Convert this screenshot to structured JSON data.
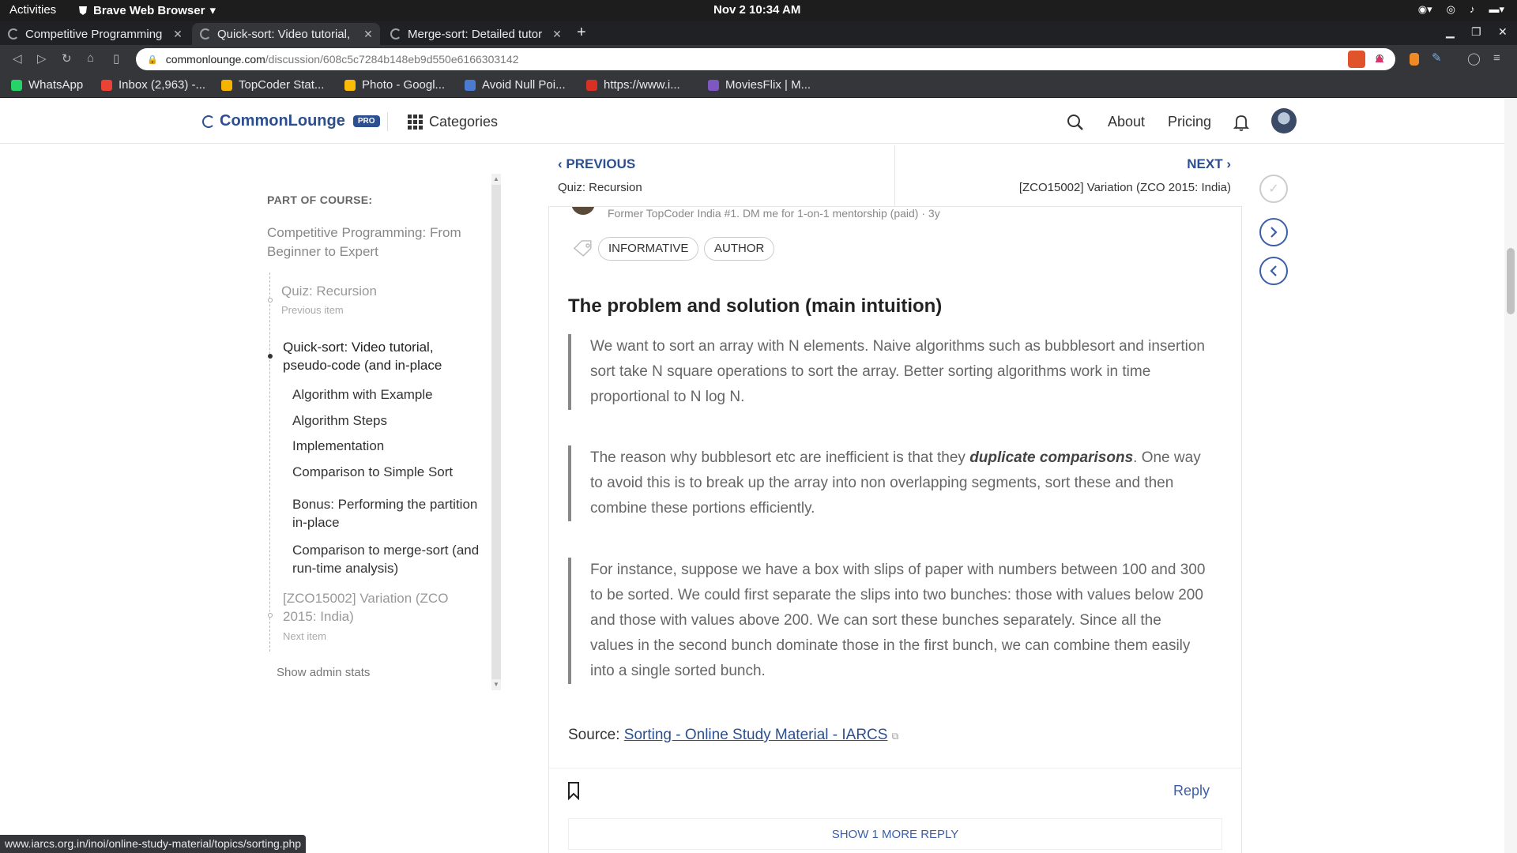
{
  "os": {
    "activities": "Activities",
    "app_name": "Brave Web Browser",
    "clock": "Nov 2  10:34 AM"
  },
  "browser": {
    "tabs": [
      {
        "title": "Competitive Programming",
        "active": false
      },
      {
        "title": "Quick-sort: Video tutorial,",
        "active": true
      },
      {
        "title": "Merge-sort: Detailed tutor",
        "active": false
      }
    ],
    "url_host": "commonlounge.com",
    "url_path": "/discussion/608c5c7284b148eb9d550e6166303142",
    "shields_count": "10",
    "bookmarks": [
      {
        "label": "WhatsApp",
        "color": "#25d366"
      },
      {
        "label": "Inbox (2,963) -...",
        "color": "#ea4335"
      },
      {
        "label": "TopCoder Stat...",
        "color": "#f4b400"
      },
      {
        "label": "Photo - Googl...",
        "color": "#fbbc05"
      },
      {
        "label": "Avoid Null Poi...",
        "color": "#4a7bd0"
      },
      {
        "label": "https://www.i...",
        "color": "#d93025"
      },
      {
        "label": "MoviesFlix | M...",
        "color": "#7e57c2"
      }
    ],
    "status_url": "www.iarcs.org.in/inoi/online-study-material/topics/sorting.php"
  },
  "site": {
    "logo": "CommonLounge",
    "pro_badge": "PRO",
    "categories": "Categories",
    "about": "About",
    "pricing": "Pricing",
    "accent": "#2c4f8f"
  },
  "sidebar": {
    "label": "PART OF COURSE:",
    "course_title": "Competitive Programming: From Beginner to Expert",
    "prev_item": {
      "title": "Quiz: Recursion",
      "sub": "Previous item"
    },
    "current_item": {
      "title": "Quick-sort: Video tutorial, pseudo-code (and in-place"
    },
    "sections": [
      "Algorithm with Example",
      "Algorithm Steps",
      "Implementation",
      "Comparison to Simple Sort",
      "Bonus: Performing the partition in-place",
      "Comparison to merge-sort (and run-time analysis)"
    ],
    "next_item": {
      "title": "[ZCO15002] Variation (ZCO 2015: India)",
      "sub": "Next item"
    },
    "admin_stats": "Show admin stats"
  },
  "nav": {
    "previous_label": "PREVIOUS",
    "previous_title": "Quiz: Recursion",
    "next_label": "NEXT",
    "next_title": "[ZCO15002] Variation (ZCO 2015: India)"
  },
  "post": {
    "author_line": "Former TopCoder India #1. DM me for 1-on-1 mentorship (paid) · 3y",
    "tags": [
      "INFORMATIVE",
      "AUTHOR"
    ],
    "heading": "The problem and solution (main intuition)",
    "quote1": "We want to sort an array with N elements. Naive algorithms such as bubblesort and insertion sort take N square operations to sort the array. Better sorting algorithms work in time proportional to N log N.",
    "quote2_before": "The reason why bubblesort etc are inefficient is that they ",
    "quote2_em": "duplicate comparisons",
    "quote2_after": ". One way to avoid this is to break up the array into non overlapping segments, sort these and then combine these portions efficiently.",
    "quote3": "For instance, suppose we have a box with slips of paper with numbers between 100 and 300 to be sorted. We could first separate the slips into two bunches: those with values below 200 and those with values above 200. We can sort these bunches separately. Since all the values in the second bunch dominate those in the first bunch, we can combine them easily into a single sorted bunch.",
    "source_label": "Source: ",
    "source_link": "Sorting - Online Study Material - IARCS",
    "reply": "Reply",
    "more_replies": "SHOW 1 MORE REPLY"
  }
}
